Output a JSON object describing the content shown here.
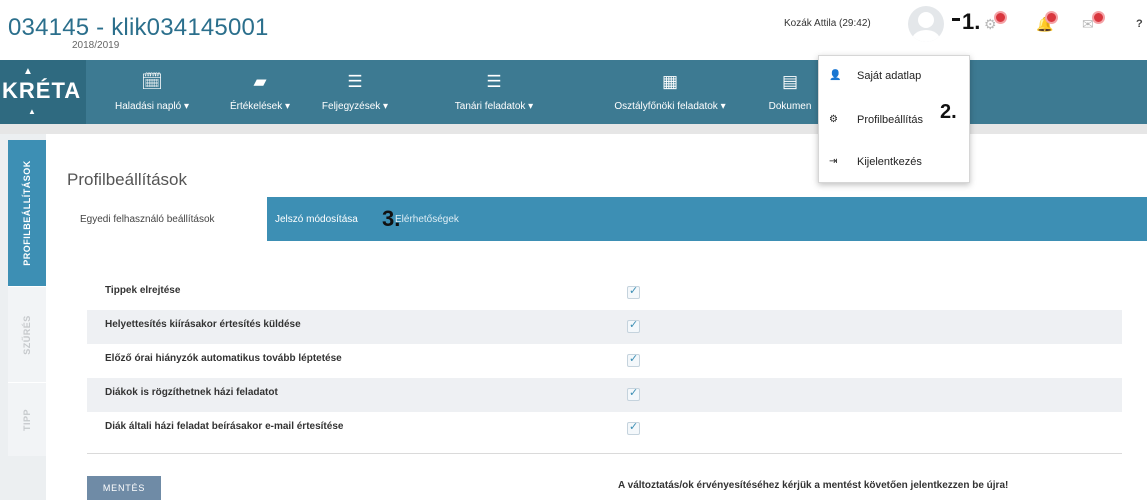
{
  "header": {
    "title": "034145 - klik034145001",
    "year": "2018/2019",
    "user": "Kozák Attila (29:42)",
    "help": "?",
    "steps": {
      "one": "1.",
      "two": "2.",
      "three": "3."
    },
    "icons": [
      "user-avatar",
      "gear-icon",
      "bell-icon",
      "envelope-icon"
    ],
    "badge_color": "#d9363e"
  },
  "logo": {
    "text": "KRÉTA"
  },
  "nav": [
    {
      "label": "Haladási napló ▾",
      "icon": "calendar-check-icon"
    },
    {
      "label": "Értékelések ▾",
      "icon": "notebook-icon"
    },
    {
      "label": "Feljegyzések ▾",
      "icon": "list-icon"
    },
    {
      "label": "Tanári feladatok ▾",
      "icon": "list-icon"
    },
    {
      "label": "Osztályfőnöki feladatok ▾",
      "icon": "grid-icon"
    },
    {
      "label": "Dokumen",
      "icon": "document-icon"
    }
  ],
  "dropdown": [
    {
      "label": "Saját adatlap",
      "icon": "user-icon"
    },
    {
      "label": "Profilbeállítás",
      "icon": "gear-icon"
    },
    {
      "label": "Kijelentkezés",
      "icon": "sign-out-icon"
    }
  ],
  "sidetabs": [
    {
      "label": "PROFILBEÁLLÍTÁSOK"
    },
    {
      "label": "SZŰRÉS"
    },
    {
      "label": "TIPP"
    }
  ],
  "page_title": "Profilbeállítások",
  "tabs": [
    {
      "label": "Egyedi felhasználó beállítások"
    },
    {
      "label": "Jelszó módosítása"
    },
    {
      "label": "Elérhetőségek"
    }
  ],
  "settings": [
    {
      "label": "Tippek elrejtése",
      "checked": true
    },
    {
      "label": "Helyettesítés kiírásakor értesítés küldése",
      "checked": true
    },
    {
      "label": "Előző órai hiányzók automatikus tovább léptetése",
      "checked": true
    },
    {
      "label": "Diákok is rögzíthetnek házi feladatot",
      "checked": true
    },
    {
      "label": "Diák általi házi feladat beírásakor e-mail értesítése",
      "checked": true
    }
  ],
  "checkmark": "✓",
  "save_label": "MENTÉS",
  "notice": "A változtatás/ok érvényesítéséhez kérjük a mentést követően jelentkezzen be újra!",
  "colors": {
    "nav": "#3d7a92",
    "accent": "#3d8fb4",
    "save": "#6f8ba6"
  }
}
